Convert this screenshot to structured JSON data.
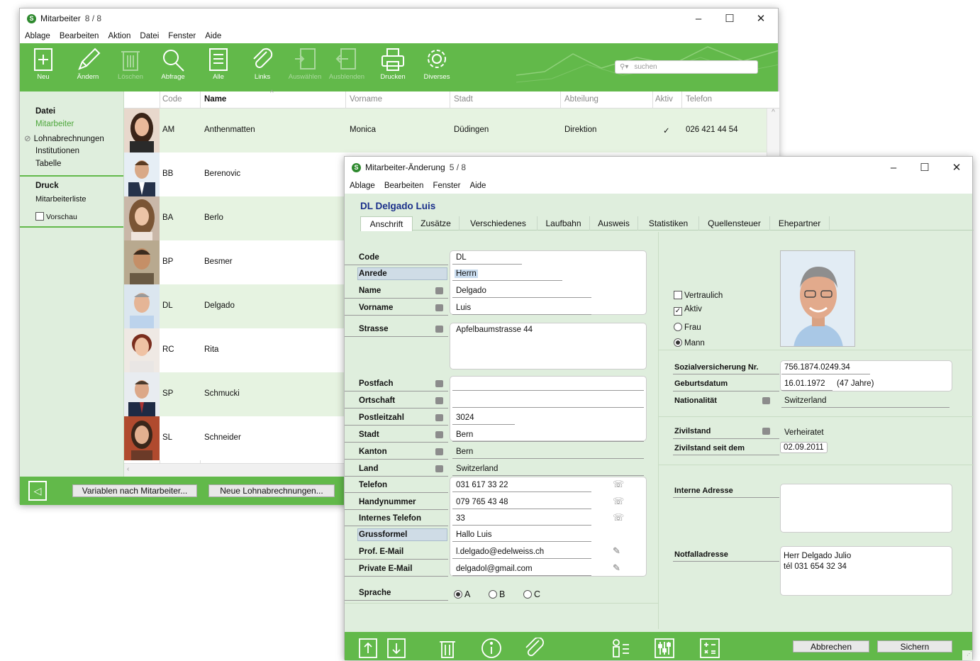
{
  "list_window": {
    "title": "Mitarbeiter",
    "counter": "8 / 8",
    "menu": [
      "Ablage",
      "Bearbeiten",
      "Aktion",
      "Datei",
      "Fenster",
      "Aide"
    ],
    "toolbar": [
      "Neu",
      "Ändern",
      "Löschen",
      "Abfrage",
      "Alle",
      "Links",
      "Auswählen",
      "Ausblenden",
      "Drucken",
      "Diverses"
    ],
    "search_placeholder": "suchen",
    "sidebar": {
      "section1": "Datei",
      "items": [
        "Mitarbeiter",
        "Lohnabrechnungen",
        "Institutionen",
        "Tabelle"
      ],
      "section2": "Druck",
      "print_items": [
        "Mitarbeiterliste"
      ],
      "preview": "Vorschau"
    },
    "columns": [
      "Code",
      "Name",
      "Vorname",
      "Stadt",
      "Abteilung",
      "Aktiv",
      "Telefon"
    ],
    "rows": [
      {
        "code": "AM",
        "name": "Anthenmatten",
        "vorname": "Monica",
        "stadt": "Düdingen",
        "abteilung": "Direktion",
        "aktiv": "✓",
        "telefon": "026 421 44 54"
      },
      {
        "code": "BB",
        "name": "Berenovic"
      },
      {
        "code": "BA",
        "name": "Berlo"
      },
      {
        "code": "BP",
        "name": "Besmer"
      },
      {
        "code": "DL",
        "name": "Delgado"
      },
      {
        "code": "RC",
        "name": "Rita"
      },
      {
        "code": "SP",
        "name": "Schmucki"
      },
      {
        "code": "SL",
        "name": "Schneider"
      }
    ],
    "footer_buttons": [
      "Variablen nach Mitarbeiter...",
      "Neue Lohnabrechnungen..."
    ]
  },
  "edit_window": {
    "title": "Mitarbeiter-Änderung",
    "counter": "5 / 8",
    "menu": [
      "Ablage",
      "Bearbeiten",
      "Fenster",
      "Aide"
    ],
    "record_title": "DL Delgado Luis",
    "tabs": [
      "Anschrift",
      "Zusätze",
      "Verschiedenes",
      "Laufbahn",
      "Ausweis",
      "Statistiken",
      "Quellensteuer",
      "Ehepartner"
    ],
    "fields": {
      "code": {
        "label": "Code",
        "value": "DL"
      },
      "anrede": {
        "label": "Anrede",
        "value": "Herrn"
      },
      "name": {
        "label": "Name",
        "value": "Delgado"
      },
      "vorname": {
        "label": "Vorname",
        "value": "Luis"
      },
      "strasse": {
        "label": "Strasse",
        "value": "Apfelbaumstrasse 44"
      },
      "postfach": {
        "label": "Postfach",
        "value": ""
      },
      "ortschaft": {
        "label": "Ortschaft",
        "value": ""
      },
      "plz": {
        "label": "Postleitzahl",
        "value": "3024"
      },
      "stadt": {
        "label": "Stadt",
        "value": "Bern"
      },
      "kanton": {
        "label": "Kanton",
        "value": "Bern"
      },
      "land": {
        "label": "Land",
        "value": "Switzerland"
      },
      "telefon": {
        "label": "Telefon",
        "value": "031 617 33 22"
      },
      "handy": {
        "label": "Handynummer",
        "value": "079 765 43 48"
      },
      "internes_telefon": {
        "label": "Internes Telefon",
        "value": "33"
      },
      "grussformel": {
        "label": "Grussformel",
        "value": "Hallo Luis"
      },
      "prof_email": {
        "label": "Prof. E-Mail",
        "value": "l.delgado@edelweiss.ch"
      },
      "private_email": {
        "label": "Private E-Mail",
        "value": "delgadol@gmail.com"
      },
      "sprache": {
        "label": "Sprache",
        "options": [
          "A",
          "B",
          "C"
        ],
        "selected": "A"
      }
    },
    "right": {
      "vertraulich": "Vertraulich",
      "aktiv": "Aktiv",
      "frau": "Frau",
      "mann": "Mann",
      "ahv_label": "Sozialversicherung Nr.",
      "ahv_value": "756.1874.0249.34",
      "geburt_label": "Geburtsdatum",
      "geburt_value": "16.01.1972",
      "alter": "(47 Jahre)",
      "nation_label": "Nationalität",
      "nation_value": "Switzerland",
      "zivil_label": "Zivilstand",
      "zivil_value": "Verheiratet",
      "zivil_seit_label": "Zivilstand seit dem",
      "zivil_seit_value": "02.09.2011",
      "intern_adr_label": "Interne Adresse",
      "notfall_label": "Notfalladresse",
      "notfall_line1": "Herr Delgado Julio",
      "notfall_line2": "tél 031 654 32 34"
    },
    "cancel_button": "Abbrechen",
    "save_button": "Sichern"
  },
  "colors": {
    "green": "#62b94a",
    "light_green": "#e6f3e1",
    "panel_bg": "#dfeedd",
    "title_blue": "#1a2f8a"
  }
}
